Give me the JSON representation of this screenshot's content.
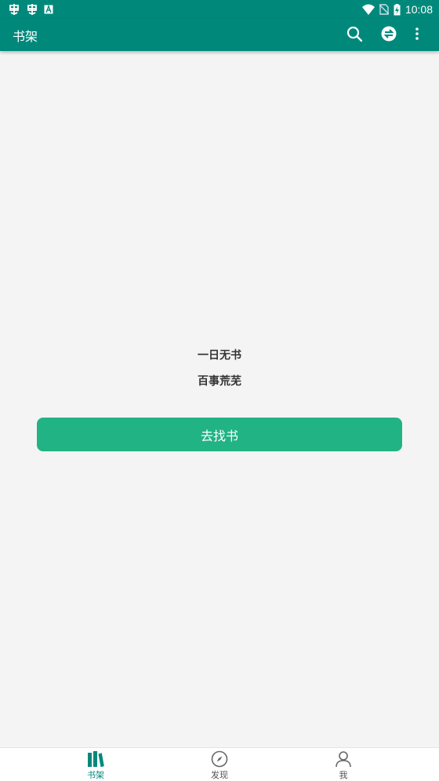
{
  "status_bar": {
    "time": "10:08",
    "left_icons": [
      "bug-icon",
      "bug-icon",
      "font-icon"
    ],
    "right_icons": [
      "wifi-icon",
      "no-sim-icon",
      "battery-charging-icon"
    ]
  },
  "app_bar": {
    "title": "书架",
    "actions": [
      "search-icon",
      "sync-icon",
      "more-vert-icon"
    ],
    "color": "#00897b"
  },
  "empty_state": {
    "line1": "一日无书",
    "line2": "百事荒芜",
    "button_label": "去找书",
    "button_color": "#21b383"
  },
  "bottom_nav": {
    "items": [
      {
        "label": "书架",
        "icon": "bookshelf-icon",
        "active": true
      },
      {
        "label": "发现",
        "icon": "compass-icon",
        "active": false
      },
      {
        "label": "我",
        "icon": "person-icon",
        "active": false
      }
    ]
  }
}
